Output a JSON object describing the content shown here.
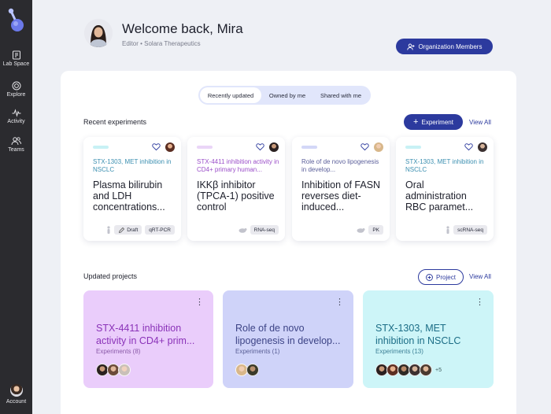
{
  "sidebar": {
    "items": [
      {
        "label": "Lab Space",
        "icon": "lab-space-icon"
      },
      {
        "label": "Explore",
        "icon": "explore-icon"
      },
      {
        "label": "Activity",
        "icon": "activity-icon"
      },
      {
        "label": "Teams",
        "icon": "teams-icon"
      }
    ],
    "account_label": "Account"
  },
  "header": {
    "welcome": "Welcome back, Mira",
    "role": "Editor • Solara Therapeutics",
    "org_members_label": "Organization Members"
  },
  "tabs": [
    {
      "label": "Recently updated",
      "active": true
    },
    {
      "label": "Owned by me",
      "active": false
    },
    {
      "label": "Shared with me",
      "active": false
    }
  ],
  "experiments_section": {
    "title": "Recent experiments",
    "add_label": "Experiment",
    "view_all": "View All",
    "cards": [
      {
        "project": "STX-1303, MET inhibition in NSCLC",
        "project_color": "#3b8fb0",
        "bar_color": "#c8f1f5",
        "title": "Plasma bilirubin and LDH concentrations...",
        "tags": [
          "Draft",
          "qRT-PCR"
        ],
        "draft": true
      },
      {
        "project": "STX-4411 inhibition activity in CD4+ primary human...",
        "project_color": "#9b4fc9",
        "bar_color": "#ead5f7",
        "title": "IKKβ inhibitor (TPCA-1) positive control",
        "tags": [
          "RNA-seq"
        ],
        "draft": false
      },
      {
        "project": "Role of de novo lipogenesis in develop...",
        "project_color": "#5b5f9a",
        "bar_color": "#d3d7f7",
        "title": "Inhibition of FASN reverses diet-induced...",
        "tags": [
          "PK"
        ],
        "draft": false
      },
      {
        "project": "STX-1303, MET inhibition in NSCLC",
        "project_color": "#3b8fb0",
        "bar_color": "#c8f1f5",
        "title": "Oral administration RBC paramet...",
        "tags": [
          "scRNA-seq"
        ],
        "draft": false
      }
    ]
  },
  "projects_section": {
    "title": "Updated projects",
    "add_label": "Project",
    "view_all": "View All",
    "cards": [
      {
        "title": "STX-4411 inhibition activity in CD4+ prim...",
        "count": "Experiments (8)",
        "bg": "#eacdfb",
        "title_color": "#8a32b8",
        "count_color": "#8a5aa8"
      },
      {
        "title": "Role of de novo lipogenesis in develop...",
        "count": "Experiments (1)",
        "bg": "#cfd3f9",
        "title_color": "#3d4486",
        "count_color": "#5a5f96"
      },
      {
        "title": "STX-1303, MET inhibition in NSCLC",
        "count": "Experiments (13)",
        "bg": "#cdf5f8",
        "title_color": "#1b6d86",
        "count_color": "#3d8096",
        "more": "+5"
      }
    ]
  }
}
